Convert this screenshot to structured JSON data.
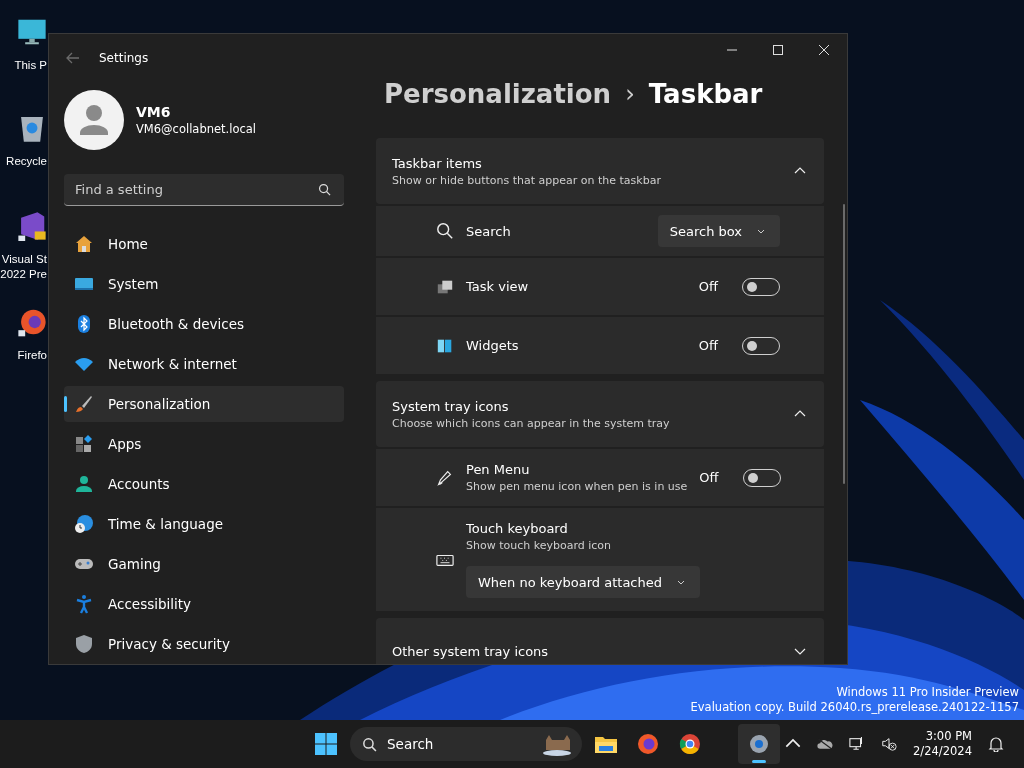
{
  "desktop": {
    "icons": [
      {
        "lines": [
          "This P"
        ]
      },
      {
        "lines": [
          "Recycle"
        ]
      },
      {
        "lines": [
          "Visual St",
          "2022 Pre"
        ]
      },
      {
        "lines": [
          "Firefo"
        ]
      }
    ]
  },
  "window": {
    "title": "Settings"
  },
  "account": {
    "name": "VM6",
    "email": "VM6@collabnet.local"
  },
  "search": {
    "placeholder": "Find a setting"
  },
  "nav": [
    {
      "label": "Home",
      "selected": false
    },
    {
      "label": "System",
      "selected": false
    },
    {
      "label": "Bluetooth & devices",
      "selected": false
    },
    {
      "label": "Network & internet",
      "selected": false
    },
    {
      "label": "Personalization",
      "selected": true
    },
    {
      "label": "Apps",
      "selected": false
    },
    {
      "label": "Accounts",
      "selected": false
    },
    {
      "label": "Time & language",
      "selected": false
    },
    {
      "label": "Gaming",
      "selected": false
    },
    {
      "label": "Accessibility",
      "selected": false
    },
    {
      "label": "Privacy & security",
      "selected": false
    }
  ],
  "breadcrumb": {
    "parent": "Personalization",
    "separator": "›",
    "current": "Taskbar"
  },
  "sections": [
    {
      "title": "Taskbar items",
      "subtitle": "Show or hide buttons that appear on the taskbar",
      "expanded": true,
      "items": [
        {
          "kind": "dropdown",
          "label": "Search",
          "value": "Search box"
        },
        {
          "kind": "toggle",
          "label": "Task view",
          "state_text": "Off",
          "on": false
        },
        {
          "kind": "toggle",
          "label": "Widgets",
          "state_text": "Off",
          "on": false
        }
      ]
    },
    {
      "title": "System tray icons",
      "subtitle": "Choose which icons can appear in the system tray",
      "expanded": true,
      "items": [
        {
          "kind": "toggle",
          "label": "Pen Menu",
          "description": "Show pen menu icon when pen is in use",
          "state_text": "Off",
          "on": false
        },
        {
          "kind": "dropdown-below",
          "label": "Touch keyboard",
          "description": "Show touch keyboard icon",
          "value": "When no keyboard attached"
        }
      ]
    },
    {
      "title": "Other system tray icons",
      "expanded": false
    }
  ],
  "watermark": [
    "Windows 11 Pro Insider Preview",
    "Evaluation copy. Build 26040.rs_prerelease.240122-1157"
  ],
  "taskbar": {
    "search_placeholder": "Search",
    "apps": [
      {
        "selected": false
      },
      {
        "selected": false
      },
      {
        "selected": false
      },
      {
        "selected": true
      }
    ],
    "time": "3:00 PM",
    "date": "2/24/2024"
  }
}
